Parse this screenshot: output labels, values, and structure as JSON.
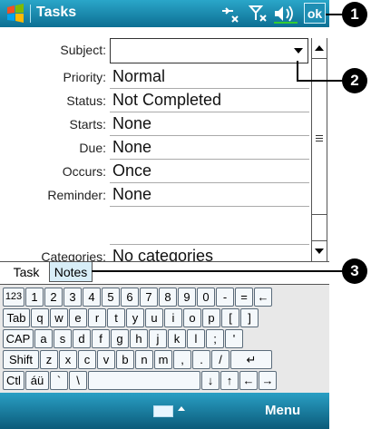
{
  "titlebar": {
    "title": "Tasks",
    "ok_label": "ok",
    "status_icons": [
      "connectivity-off-icon",
      "signal-off-icon",
      "speaker-icon"
    ]
  },
  "form": {
    "fields": [
      {
        "label": "Subject:",
        "value": ""
      },
      {
        "label": "Priority:",
        "value": "Normal"
      },
      {
        "label": "Status:",
        "value": "Not Completed"
      },
      {
        "label": "Starts:",
        "value": "None"
      },
      {
        "label": "Due:",
        "value": "None"
      },
      {
        "label": "Occurs:",
        "value": "Once"
      },
      {
        "label": "Reminder:",
        "value": "None"
      },
      {
        "label": "Categories:",
        "value": "No categories"
      }
    ]
  },
  "tabs": [
    {
      "label": "Task",
      "active": true
    },
    {
      "label": "Notes",
      "active": false
    }
  ],
  "keyboard": {
    "row1": [
      "123",
      "1",
      "2",
      "3",
      "4",
      "5",
      "6",
      "7",
      "8",
      "9",
      "0",
      "-",
      "=",
      "←"
    ],
    "row2": [
      "Tab",
      "q",
      "w",
      "e",
      "r",
      "t",
      "y",
      "u",
      "i",
      "o",
      "p",
      "[",
      "]"
    ],
    "row3": [
      "CAP",
      "a",
      "s",
      "d",
      "f",
      "g",
      "h",
      "j",
      "k",
      "l",
      ";",
      "'"
    ],
    "row4": [
      "Shift",
      "z",
      "x",
      "c",
      "v",
      "b",
      "n",
      "m",
      ",",
      ".",
      "/",
      "↵"
    ],
    "row5": [
      "Ctl",
      "áü",
      "`",
      "\\",
      "",
      "↓",
      "↑",
      "←",
      "→"
    ]
  },
  "bottombar": {
    "menu_label": "Menu"
  },
  "callouts": [
    "1",
    "2",
    "3"
  ],
  "colors": {
    "titlebar": "#1a8ab0",
    "tab_notes": "#d8eef8",
    "keyboard": "#e8e8e8"
  }
}
